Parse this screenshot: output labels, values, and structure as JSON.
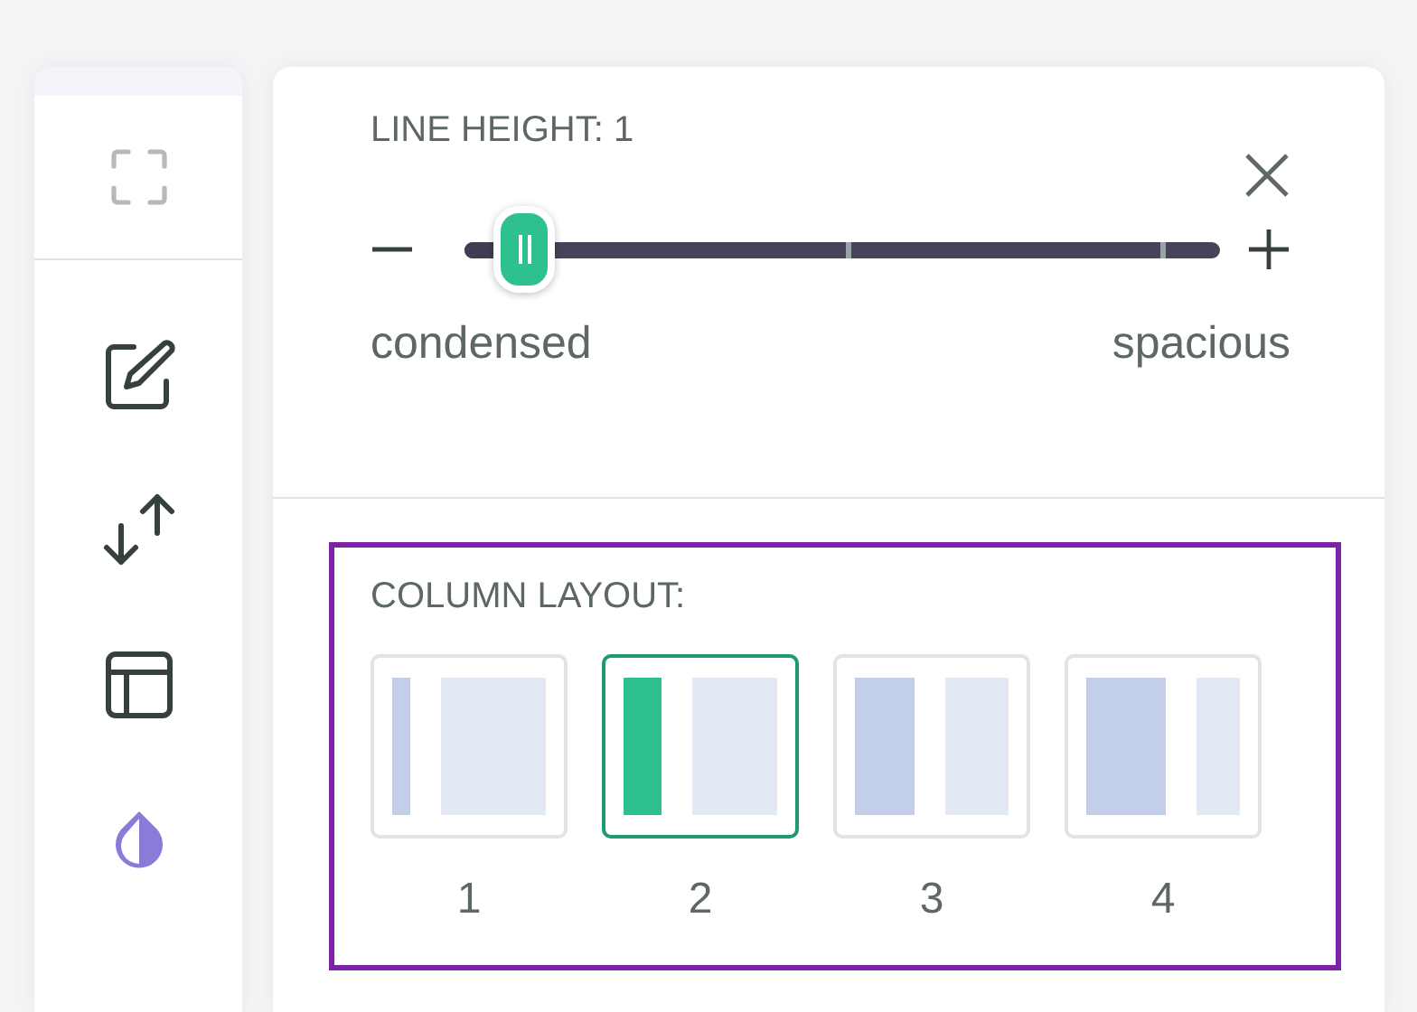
{
  "sidebar": {
    "items": [
      {
        "kind": "fullscreen",
        "selected": false
      },
      {
        "kind": "edit",
        "selected": false
      },
      {
        "kind": "swap",
        "selected": false
      },
      {
        "kind": "layout",
        "selected": false
      },
      {
        "kind": "theme",
        "selected": true
      }
    ]
  },
  "line_height": {
    "label": "LINE HEIGHT: 1",
    "level": 0.08,
    "min_label": "condensed",
    "max_label": "spacious"
  },
  "column_layout": {
    "label": "COLUMN LAYOUT:",
    "focused": true,
    "options": [
      {
        "label": "1",
        "selected": false
      },
      {
        "label": "2",
        "selected": true
      },
      {
        "label": "3",
        "selected": false
      },
      {
        "label": "4",
        "selected": false
      }
    ]
  }
}
